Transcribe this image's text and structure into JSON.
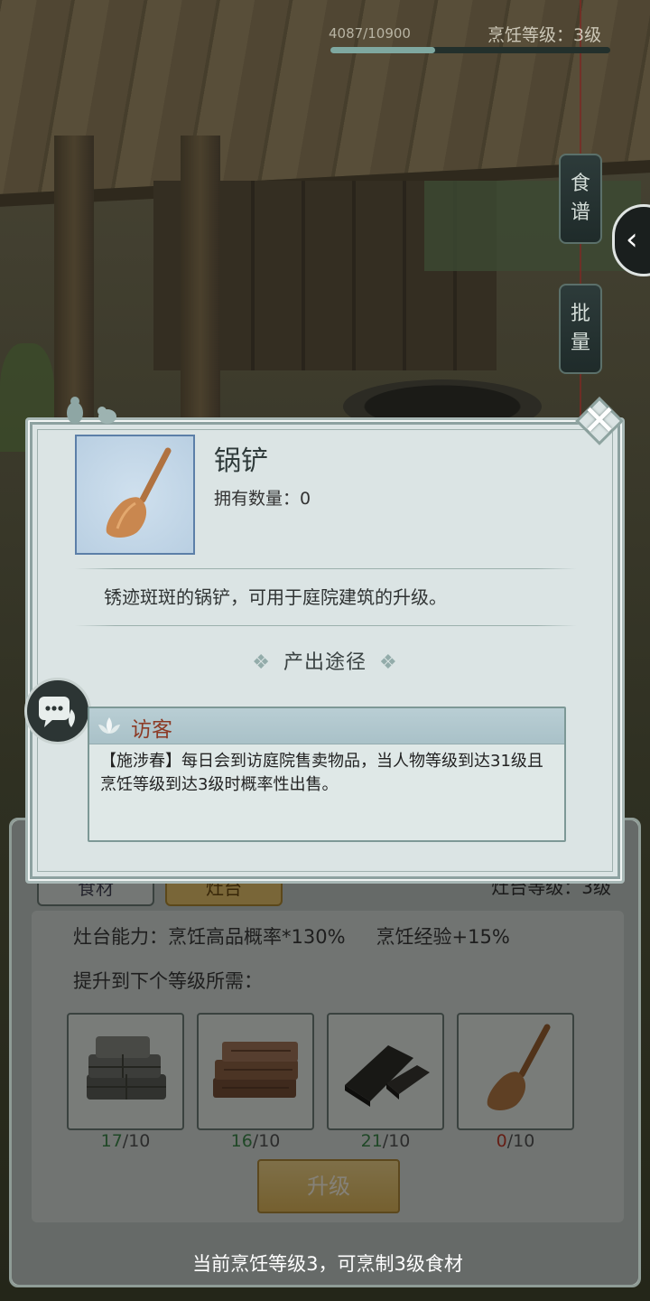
{
  "hud": {
    "exp_text": "4087/10900",
    "exp_progress": 0.375,
    "cook_level": "烹饪等级：3级",
    "side_buttons": [
      "食谱",
      "批量"
    ],
    "collapse_icon": "chevron-left-icon"
  },
  "dialog": {
    "item_name": "锅铲",
    "owned_label": "拥有数量：0",
    "description": "锈迹斑斑的锅铲，可用于庭院建筑的升级。",
    "source_title": "产出途径",
    "source_card": {
      "label": "访客",
      "text": "【施涉春】每日会到访庭院售卖物品，当人物等级到达31级且烹饪等级到达3级时概率性出售。"
    },
    "close_icon": "close-icon"
  },
  "stove_panel": {
    "tabs": [
      "食材",
      "灶台"
    ],
    "level_text": "灶台等级：3级",
    "ability": "灶台能力：烹饪高品概率*130%",
    "ability2": "烹饪经验+15%",
    "need_label": "提升到下个等级所需：",
    "materials": [
      {
        "name": "stone-material",
        "have": "17",
        "need": "/10"
      },
      {
        "name": "wood-material",
        "have": "16",
        "need": "/10"
      },
      {
        "name": "iron-material",
        "have": "21",
        "need": "/10"
      },
      {
        "name": "spatula-material",
        "have": "0",
        "need": "/10"
      }
    ],
    "upgrade_label": "升级",
    "note": "当前烹饪等级3，可烹制3级食材"
  },
  "colors": {
    "dialog_bg": "#dbe4e4",
    "source_label": "#8c3a25",
    "have_ok": "#3f8a4c",
    "have_low": "#c23a2a"
  }
}
